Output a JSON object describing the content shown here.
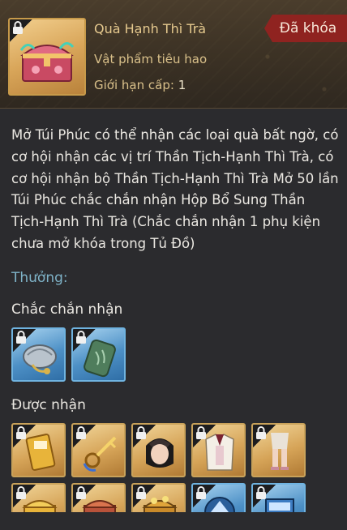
{
  "item": {
    "name": "Quà Hạnh Thì Trà",
    "type": "Vật phẩm tiêu hao",
    "level_label": "Giới hạn cấp:",
    "level_value": "1",
    "status": "Đã khóa",
    "icon": "chest-icon"
  },
  "description": "Mở Túi Phúc có thể nhận các loại quà bất ngờ, có cơ hội nhận các vị trí Thần Tịch-Hạnh Thì Trà, có cơ hội nhận bộ Thần Tịch-Hạnh Thì Trà Mở 50 lần Túi Phúc chắc chắn nhận Hộp Bổ Sung Thần Tịch-Hạnh Thì Trà (Chắc chắn nhận 1 phụ kiện chưa mở khóa trong Tủ Đồ)",
  "rewards": {
    "heading": "Thưởng:",
    "guaranteed_label": "Chắc chắn nhận",
    "possible_label": "Được nhận",
    "guaranteed": [
      {
        "icon": "silver-sachet-icon",
        "rarity": "blue"
      },
      {
        "icon": "jade-token-icon",
        "rarity": "blue"
      }
    ],
    "possible_row1": [
      {
        "icon": "card-icon",
        "rarity": "gold"
      },
      {
        "icon": "key-icon",
        "rarity": "gold"
      },
      {
        "icon": "hairstyle-icon",
        "rarity": "gold"
      },
      {
        "icon": "outfit-icon",
        "rarity": "gold"
      },
      {
        "icon": "legs-outfit-icon",
        "rarity": "gold"
      }
    ],
    "possible_row2": [
      {
        "icon": "gold-chest-icon",
        "rarity": "gold"
      },
      {
        "icon": "red-chest-icon",
        "rarity": "gold"
      },
      {
        "icon": "treasure-chest-icon",
        "rarity": "gold"
      },
      {
        "icon": "upgrade-arrow-icon",
        "rarity": "blue"
      },
      {
        "icon": "blue-box-icon",
        "rarity": "blue"
      }
    ]
  },
  "colors": {
    "locked_tag": "#8f2320",
    "title": "#e5c98e",
    "reward_heading": "#7fb3c8",
    "gold_frame": "#c9a25a",
    "blue_frame": "#6fb3e0"
  }
}
